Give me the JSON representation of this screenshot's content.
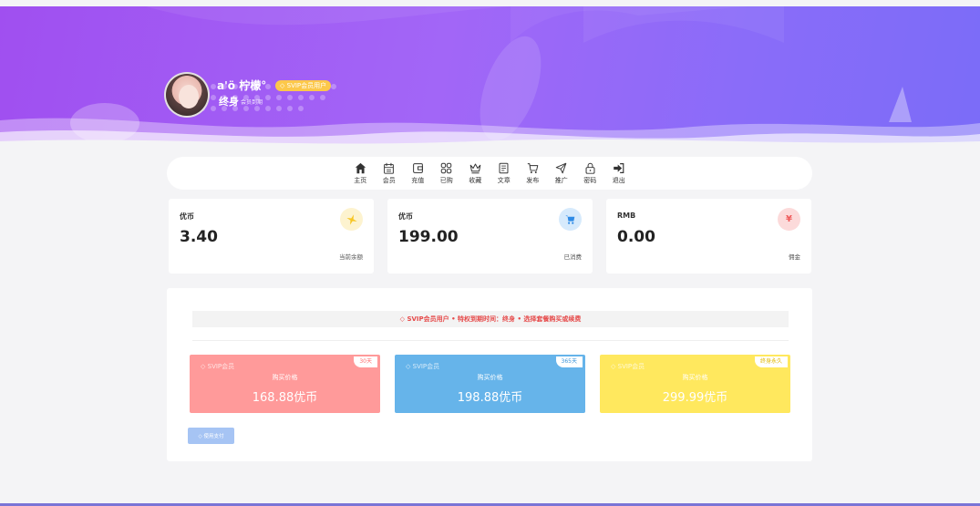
{
  "profile": {
    "username": "a'ö 柠檬°",
    "vip_badge": "SVIP会员用户",
    "vip_term": "终身",
    "vip_term_note": "会员到期"
  },
  "nav": {
    "items": [
      {
        "label": "主页",
        "icon": "home-icon"
      },
      {
        "label": "会员",
        "icon": "calendar-icon"
      },
      {
        "label": "充值",
        "icon": "wallet-icon"
      },
      {
        "label": "已购",
        "icon": "grid-icon"
      },
      {
        "label": "收藏",
        "icon": "crown-icon"
      },
      {
        "label": "文章",
        "icon": "document-icon"
      },
      {
        "label": "发布",
        "icon": "cart-icon"
      },
      {
        "label": "推广",
        "icon": "send-icon"
      },
      {
        "label": "密码",
        "icon": "lock-icon"
      },
      {
        "label": "退出",
        "icon": "logout-icon"
      }
    ]
  },
  "stats": [
    {
      "title": "优币",
      "value": "3.40",
      "caption": "当前余额",
      "icon": "sparkle-icon",
      "icon_color": "#f7c624",
      "icon_bg": "#fdf3cf"
    },
    {
      "title": "优币",
      "value": "199.00",
      "caption": "已消费",
      "icon": "cart-icon",
      "icon_color": "#2f8be6",
      "icon_bg": "#d6eafc"
    },
    {
      "title": "RMB",
      "value": "0.00",
      "caption": "佣金",
      "icon": "yen-icon",
      "icon_color": "#ef5a5a",
      "icon_bg": "#fcdada"
    }
  ],
  "notice": "SVIP会员用户 • 特权到期时间：终身 • 选择套餐购买或续费",
  "plans": [
    {
      "tag": "SVIP会员",
      "days": "30天",
      "price_label": "购买价格",
      "price": "168.88优币",
      "color": "#ff9a9a",
      "days_color": "#ff7070"
    },
    {
      "tag": "SVIP会员",
      "days": "365天",
      "price_label": "购买价格",
      "price": "198.88优币",
      "color": "#66b4ea",
      "days_color": "#3b94d9"
    },
    {
      "tag": "SVIP会员",
      "days": "终身永久",
      "price_label": "购买价格",
      "price": "299.99优币",
      "color": "#ffe85e",
      "days_color": "#e0b800"
    }
  ],
  "pay_button": "使用支付",
  "colors": {
    "hero_start": "#a04ff0",
    "hero_end": "#7b6cf8",
    "vip_gold": "#fcc84a",
    "notice_red": "#e64a4a"
  }
}
